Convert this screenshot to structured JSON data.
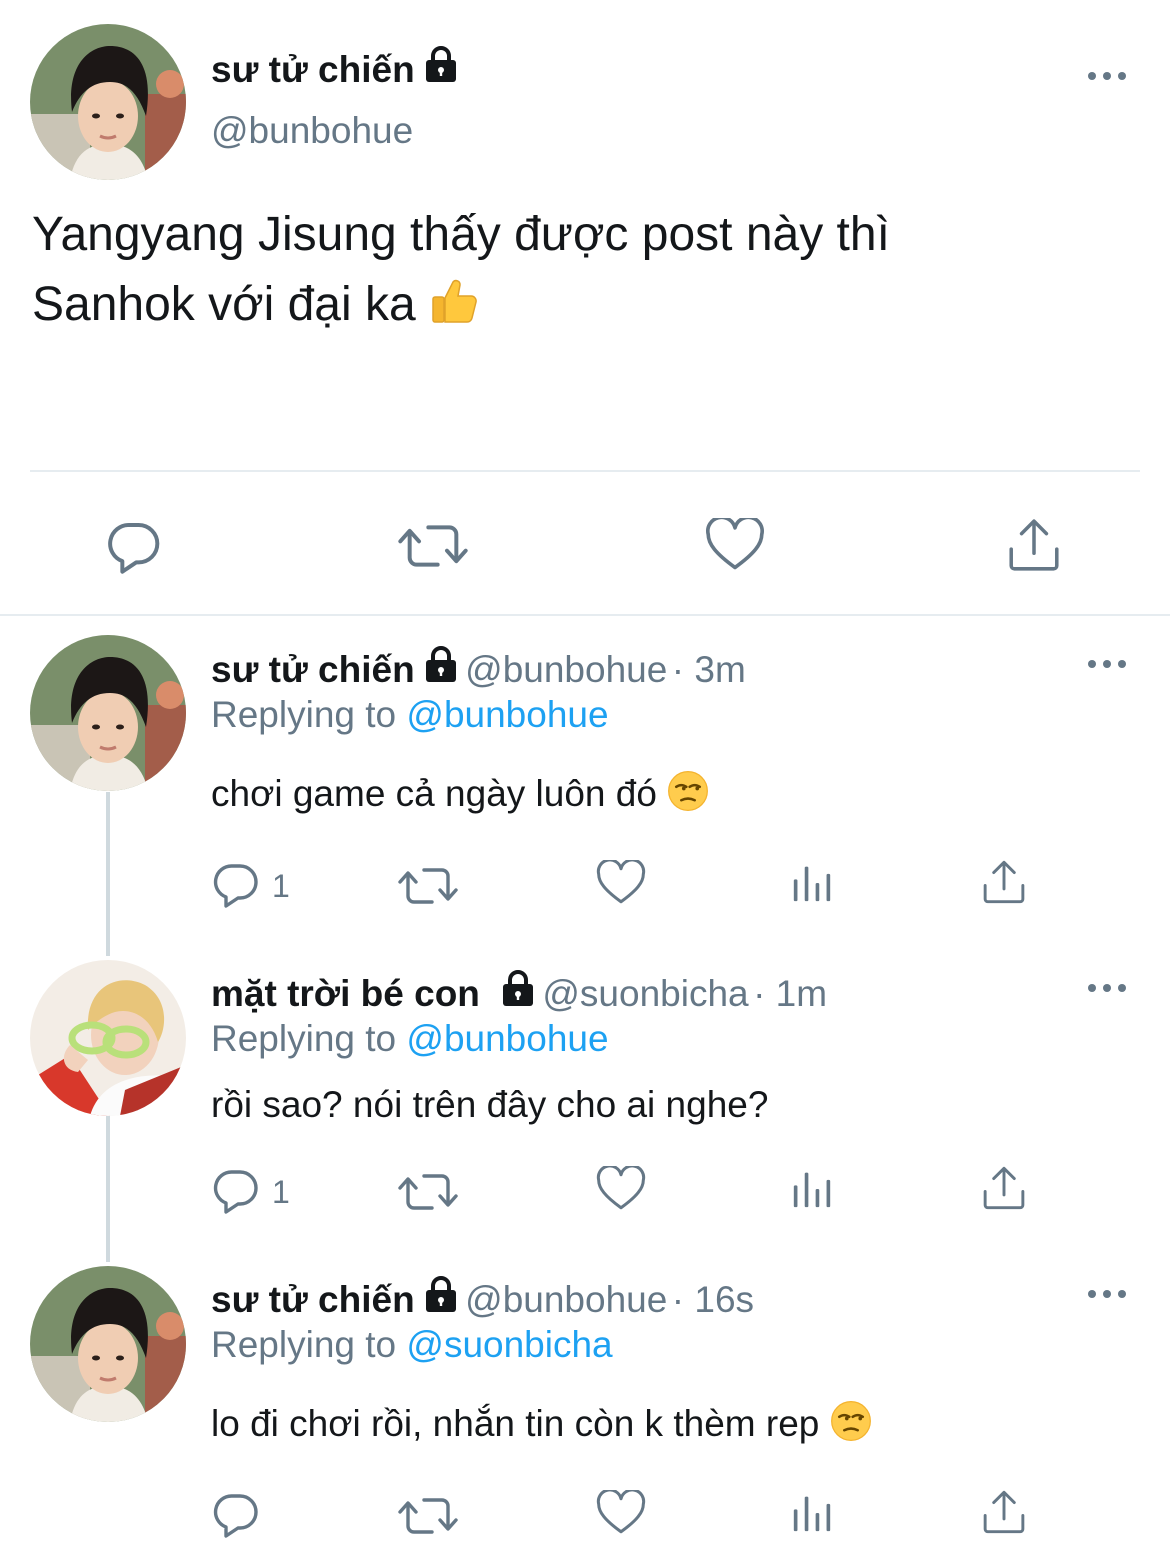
{
  "main_tweet": {
    "display_name": "sư tử chiến",
    "handle": "@bunbohue",
    "text_line1": "Yangyang Jisung thấy được post này thì",
    "text_line2": "Sanhok với đại ka"
  },
  "replies": [
    {
      "display_name": "sư tử chiến",
      "handle": "@bunbohue",
      "time": "· 3m",
      "replying_prefix": "Replying to",
      "replying_to": "@bunbohue",
      "text": "chơi game cả ngày luôn đó",
      "reply_count": "1"
    },
    {
      "display_name": "mặt trời bé con",
      "handle": "@suonbicha",
      "time": "· 1m",
      "replying_prefix": "Replying to",
      "replying_to": "@bunbohue",
      "text": "rồi sao? nói trên đây cho ai nghe?",
      "reply_count": "1"
    },
    {
      "display_name": "sư tử chiến",
      "handle": "@bunbohue",
      "time": "· 16s",
      "replying_prefix": "Replying to",
      "replying_to": "@suonbicha",
      "text": "lo đi chơi rồi, nhắn tin còn k thèm rep",
      "reply_count": ""
    }
  ],
  "colors": {
    "text": "#14171a",
    "secondary": "#657786",
    "accent": "#1da1f2",
    "divider": "#e6ecf0"
  }
}
